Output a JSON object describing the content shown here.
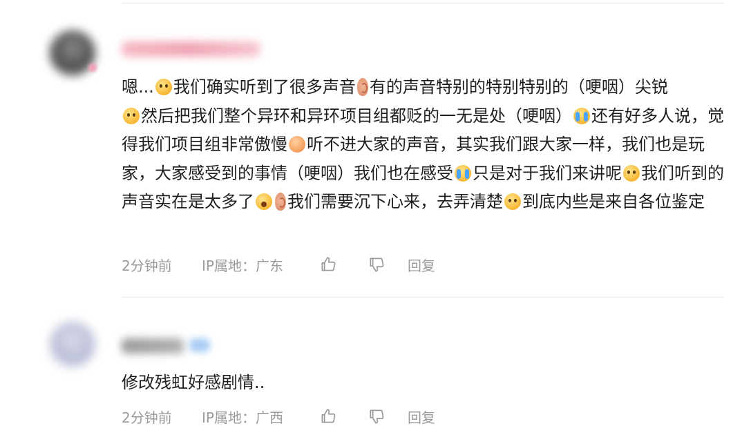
{
  "comments": [
    {
      "text_parts": [
        "嗯...",
        "我们确实听到了很多声音",
        "有的声音特别的特别特别的（哽咽）尖锐",
        "然后把我们整个异环和异环项目组都贬的一无是处（哽咽）",
        "还有好多人说，觉得我们项目组非常傲慢",
        "听不进大家的声音，其实我们跟大家一样，我们也是玩家，大家感受到的事情（哽咽）我们也在感受",
        "只是对于我们来讲呢",
        "我们听到的声音实在是太多了",
        "我们需要沉下心来，去弄清楚",
        "到底内些是来自各位鉴定"
      ],
      "emojis": [
        "neutral-face-emoji",
        "ear-emoji",
        "worried-face-emoji",
        "crying-face-emoji",
        "steam-face-emoji",
        "dizzy-face-emoji",
        "exploding-head-emoji",
        "ear-emoji",
        "thinking-face-emoji"
      ],
      "time": "2分钟前",
      "ip": "IP属地：广东",
      "reply_label": "回复"
    },
    {
      "text": "修改残虹好感剧情..",
      "time": "2分钟前",
      "ip": "IP属地：广西",
      "reply_label": "回复"
    }
  ],
  "colors": {
    "meta": "#9a9a9a",
    "text": "#1f1f1f",
    "divider": "#ececec"
  }
}
